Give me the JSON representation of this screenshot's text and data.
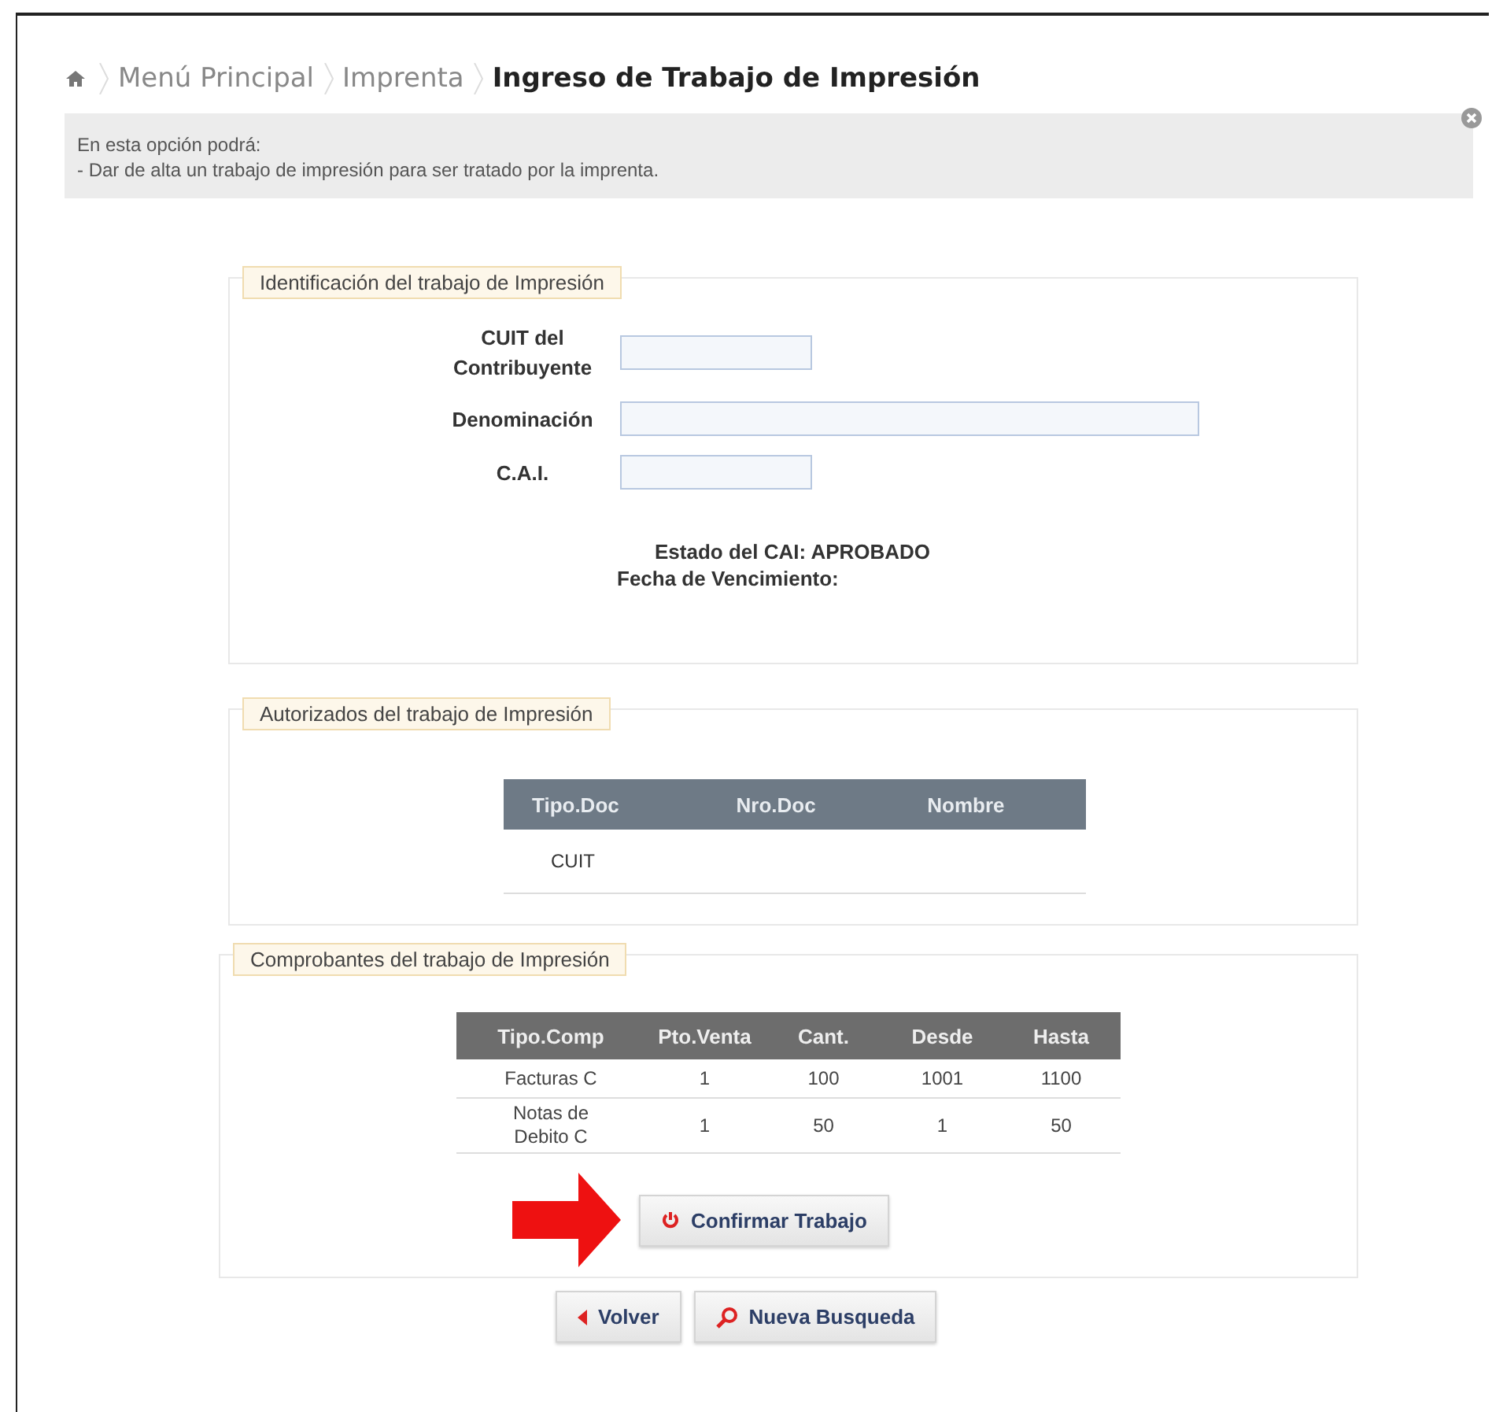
{
  "breadcrumb": [
    {
      "label": "Menú Principal",
      "current": false
    },
    {
      "label": "Imprenta",
      "current": false
    },
    {
      "label": "Ingreso de Trabajo de Impresión",
      "current": true
    }
  ],
  "info": {
    "lines": [
      "En esta opción podrá:",
      "- Dar de alta un trabajo de impresión para ser tratado por la imprenta."
    ]
  },
  "identificacion": {
    "legend": "Identificación del trabajo de Impresión",
    "fields": [
      {
        "label": "CUIT del Contribuyente",
        "kind": "short"
      },
      {
        "label": "Denominación",
        "kind": "long"
      },
      {
        "label": "C.A.I.",
        "kind": "short"
      }
    ],
    "estado": "Estado del CAI: APROBADO",
    "vencimiento": "Fecha de Vencimiento:"
  },
  "autorizados": {
    "legend": "Autorizados del trabajo de Impresión",
    "columns": [
      "Tipo.Doc",
      "Nro.Doc",
      "Nombre"
    ],
    "rows": [
      [
        "CUIT",
        "",
        ""
      ]
    ]
  },
  "comprobantes": {
    "legend": "Comprobantes del trabajo de Impresión",
    "columns": [
      "Tipo.Comp",
      "Pto.Venta",
      "Cant.",
      "Desde",
      "Hasta"
    ],
    "rows": [
      [
        "Facturas C",
        "1",
        "100",
        "1001",
        "1100"
      ],
      [
        "Notas de Debito C",
        "1",
        "50",
        "1",
        "50"
      ]
    ]
  },
  "confirm_button": "Confirmar Trabajo",
  "buttons": [
    {
      "kind": "back",
      "label": "Volver"
    },
    {
      "kind": "search",
      "label": "Nueva Busqueda"
    }
  ]
}
